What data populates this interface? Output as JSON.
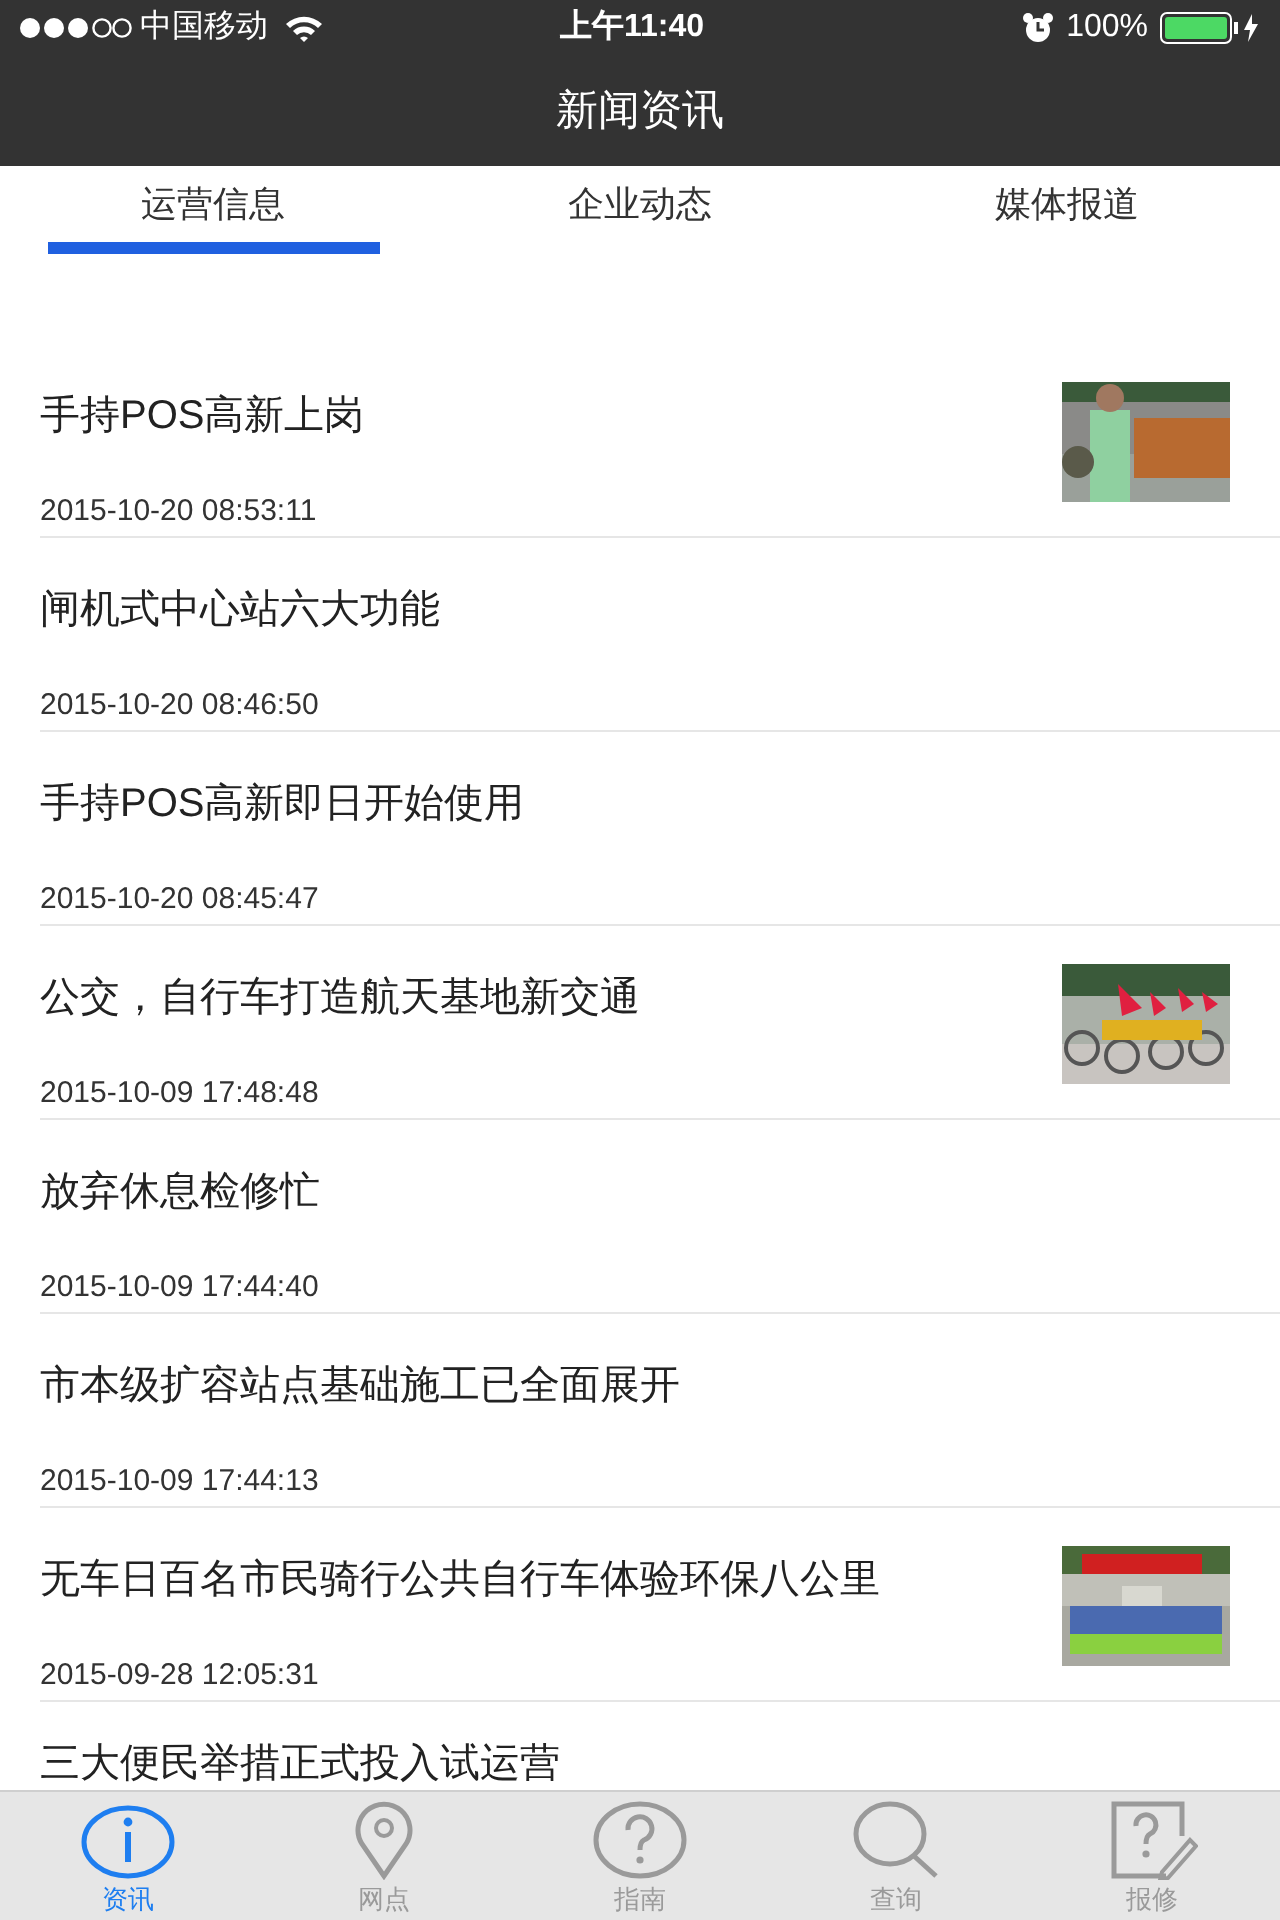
{
  "status_bar": {
    "carrier": "中国移动",
    "time": "上午11:40",
    "battery": "100%"
  },
  "nav_bar": {
    "title": "新闻资讯"
  },
  "tabs": [
    {
      "label": "运营信息",
      "selected": true
    },
    {
      "label": "企业动态",
      "selected": false
    },
    {
      "label": "媒体报道",
      "selected": false
    }
  ],
  "news": [
    {
      "title": "手持POS高新上岗",
      "date": "2015-10-20 08:53:11",
      "has_picture": true
    },
    {
      "title": "闸机式中心站六大功能",
      "date": "2015-10-20 08:46:50",
      "has_picture": false
    },
    {
      "title": "手持POS高新即日开始使用",
      "date": "2015-10-20 08:45:47",
      "has_picture": false
    },
    {
      "title": "公交，自行车打造航天基地新交通",
      "date": "2015-10-09 17:48:48",
      "has_picture": true
    },
    {
      "title": "放弃休息检修忙",
      "date": "2015-10-09 17:44:40",
      "has_picture": false
    },
    {
      "title": "市本级扩容站点基础施工已全面展开",
      "date": "2015-10-09 17:44:13",
      "has_picture": false
    },
    {
      "title": "无车日百名市民骑行公共自行车体验环保八公里",
      "date": "2015-09-28 12:05:31",
      "has_picture": true
    },
    {
      "title": "三大便民举措正式投入试运营",
      "has_picture": false
    }
  ],
  "tab_bar": [
    {
      "label": "资讯",
      "selected": true
    },
    {
      "label": "网点",
      "selected": false
    },
    {
      "label": "指南",
      "selected": false
    },
    {
      "label": "查询",
      "selected": false
    },
    {
      "label": "报修",
      "selected": false
    }
  ]
}
